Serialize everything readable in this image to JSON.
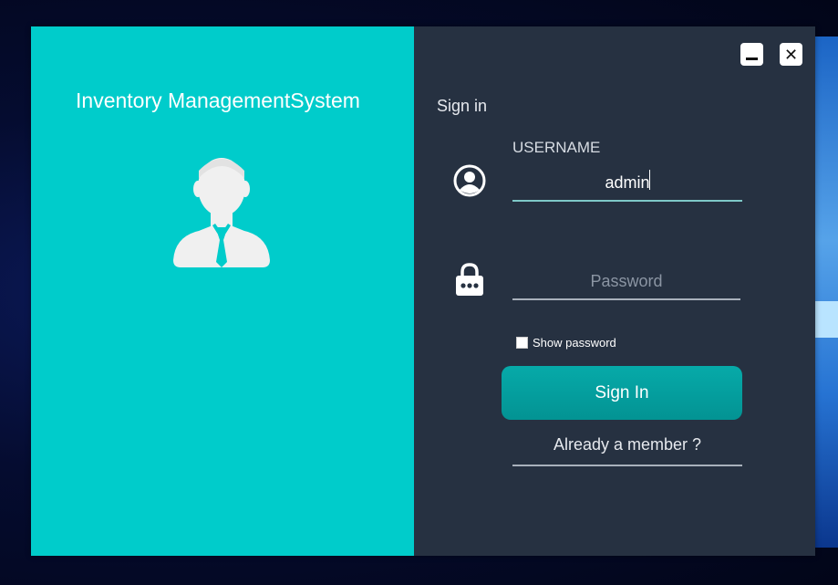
{
  "app": {
    "title": "Inventory ManagementSystem"
  },
  "window_controls": {
    "minimize": "minimize-icon",
    "close": "close-icon",
    "close_glyph": "✕"
  },
  "form": {
    "heading": "Sign in",
    "username_label": "USERNAME",
    "username_value": "admin",
    "password_placeholder": "Password",
    "show_password_label": "Show password",
    "signin_label": "Sign In",
    "member_link": "Already a member ?"
  },
  "colors": {
    "left_panel": "#00cccb",
    "right_panel": "#263141",
    "button": "#06aaa9"
  },
  "icons": {
    "avatar": "businessman-icon",
    "user": "user-circle-icon",
    "lock": "padlock-icon"
  }
}
